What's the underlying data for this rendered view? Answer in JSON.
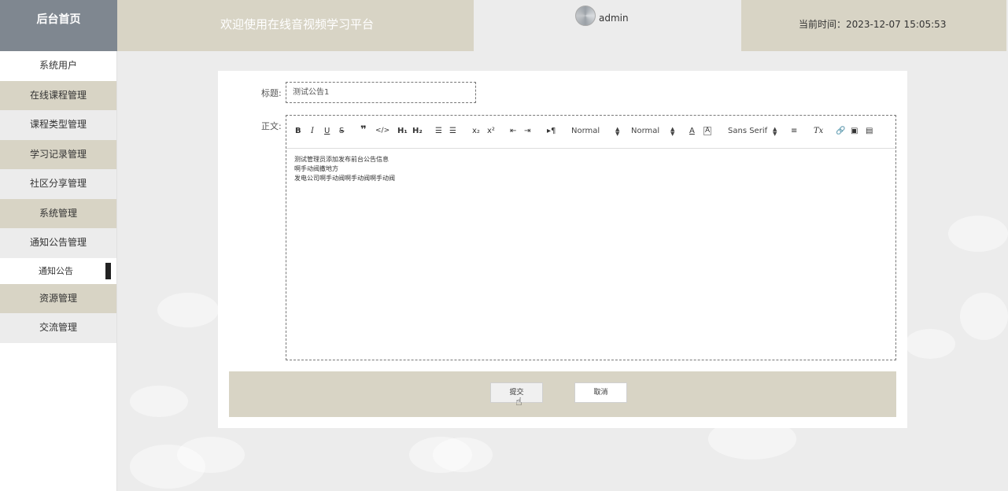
{
  "header": {
    "brand": "后台首页",
    "welcome": "欢迎使用在线音视频学习平台",
    "username": "admin",
    "time_label": "当前时间：2023-12-07 15:05:53"
  },
  "sidebar": {
    "items": [
      {
        "label": "系统用户"
      },
      {
        "label": "在线课程管理"
      },
      {
        "label": "课程类型管理"
      },
      {
        "label": "学习记录管理"
      },
      {
        "label": "社区分享管理"
      },
      {
        "label": "系统管理"
      },
      {
        "label": "通知公告管理"
      },
      {
        "label": "通知公告"
      },
      {
        "label": "资源管理"
      },
      {
        "label": "交流管理"
      }
    ]
  },
  "form": {
    "title_label": "标题:",
    "title_value": "测试公告1",
    "body_label": "正文:",
    "toolbar": {
      "header_select": "Normal",
      "size_select": "Normal",
      "font_select": "Sans Serif"
    },
    "body_lines": [
      "测试管理员添加发布前台公告信息",
      "啊手动阀撒地方",
      "发电公司啊手动阀啊手动阀啊手动阀"
    ],
    "submit_label": "提交",
    "cancel_label": "取消"
  },
  "colors": {
    "brand_bg": "#7f8790",
    "accent_beige": "#d8d4c5",
    "page_bg": "#ececec"
  }
}
